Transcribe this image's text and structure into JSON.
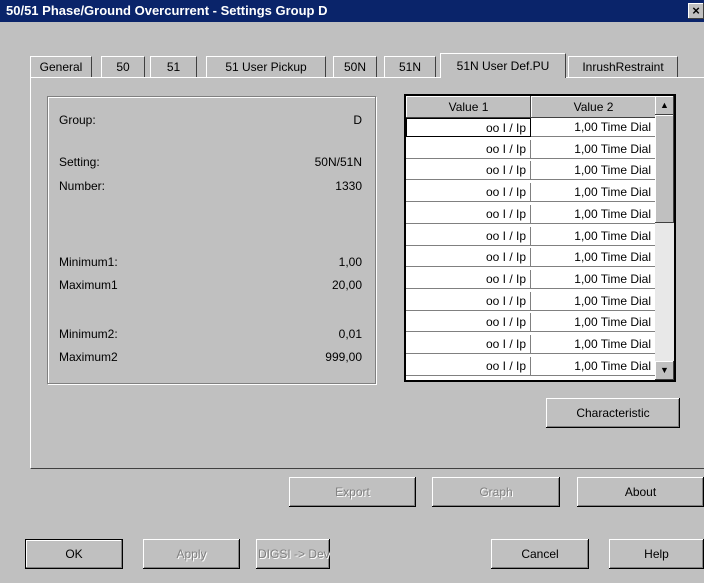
{
  "window": {
    "title": "50/51 Phase/Ground Overcurrent - Settings Group D",
    "close_glyph": "×"
  },
  "tabs": [
    {
      "label": "General"
    },
    {
      "label": "50"
    },
    {
      "label": "51"
    },
    {
      "label": "51 User Pickup"
    },
    {
      "label": "50N"
    },
    {
      "label": "51N"
    },
    {
      "label": "51N User Def.PU"
    },
    {
      "label": "InrushRestraint"
    }
  ],
  "active_tab": "51N User Def.PU",
  "info": {
    "group_label": "Group:",
    "group_value": "D",
    "setting_label": "Setting:",
    "setting_value": "50N/51N",
    "number_label": "Number:",
    "number_value": "1330",
    "min1_label": "Minimum1:",
    "min1_value": "1,00",
    "max1_label": "Maximum1",
    "max1_value": "20,00",
    "min2_label": "Minimum2:",
    "min2_value": "0,01",
    "max2_label": "Maximum2",
    "max2_value": "999,00"
  },
  "grid": {
    "headers": [
      "Value 1",
      "Value 2"
    ],
    "rows": [
      [
        "oo I / Ip",
        "1,00 Time Dial"
      ],
      [
        "oo I / Ip",
        "1,00 Time Dial"
      ],
      [
        "oo I / Ip",
        "1,00 Time Dial"
      ],
      [
        "oo I / Ip",
        "1,00 Time Dial"
      ],
      [
        "oo I / Ip",
        "1,00 Time Dial"
      ],
      [
        "oo I / Ip",
        "1,00 Time Dial"
      ],
      [
        "oo I / Ip",
        "1,00 Time Dial"
      ],
      [
        "oo I / Ip",
        "1,00 Time Dial"
      ],
      [
        "oo I / Ip",
        "1,00 Time Dial"
      ],
      [
        "oo I / Ip",
        "1,00 Time Dial"
      ],
      [
        "oo I / Ip",
        "1,00 Time Dial"
      ],
      [
        "oo I / Ip",
        "1,00 Time Dial"
      ]
    ],
    "scroll_up_glyph": "▲",
    "scroll_down_glyph": "▼"
  },
  "buttons": {
    "characteristic": "Characteristic",
    "export": "Export",
    "graph": "Graph",
    "about": "About",
    "ok": "OK",
    "apply": "Apply",
    "digsi": "DIGSI -> Device",
    "cancel": "Cancel",
    "help": "Help"
  }
}
